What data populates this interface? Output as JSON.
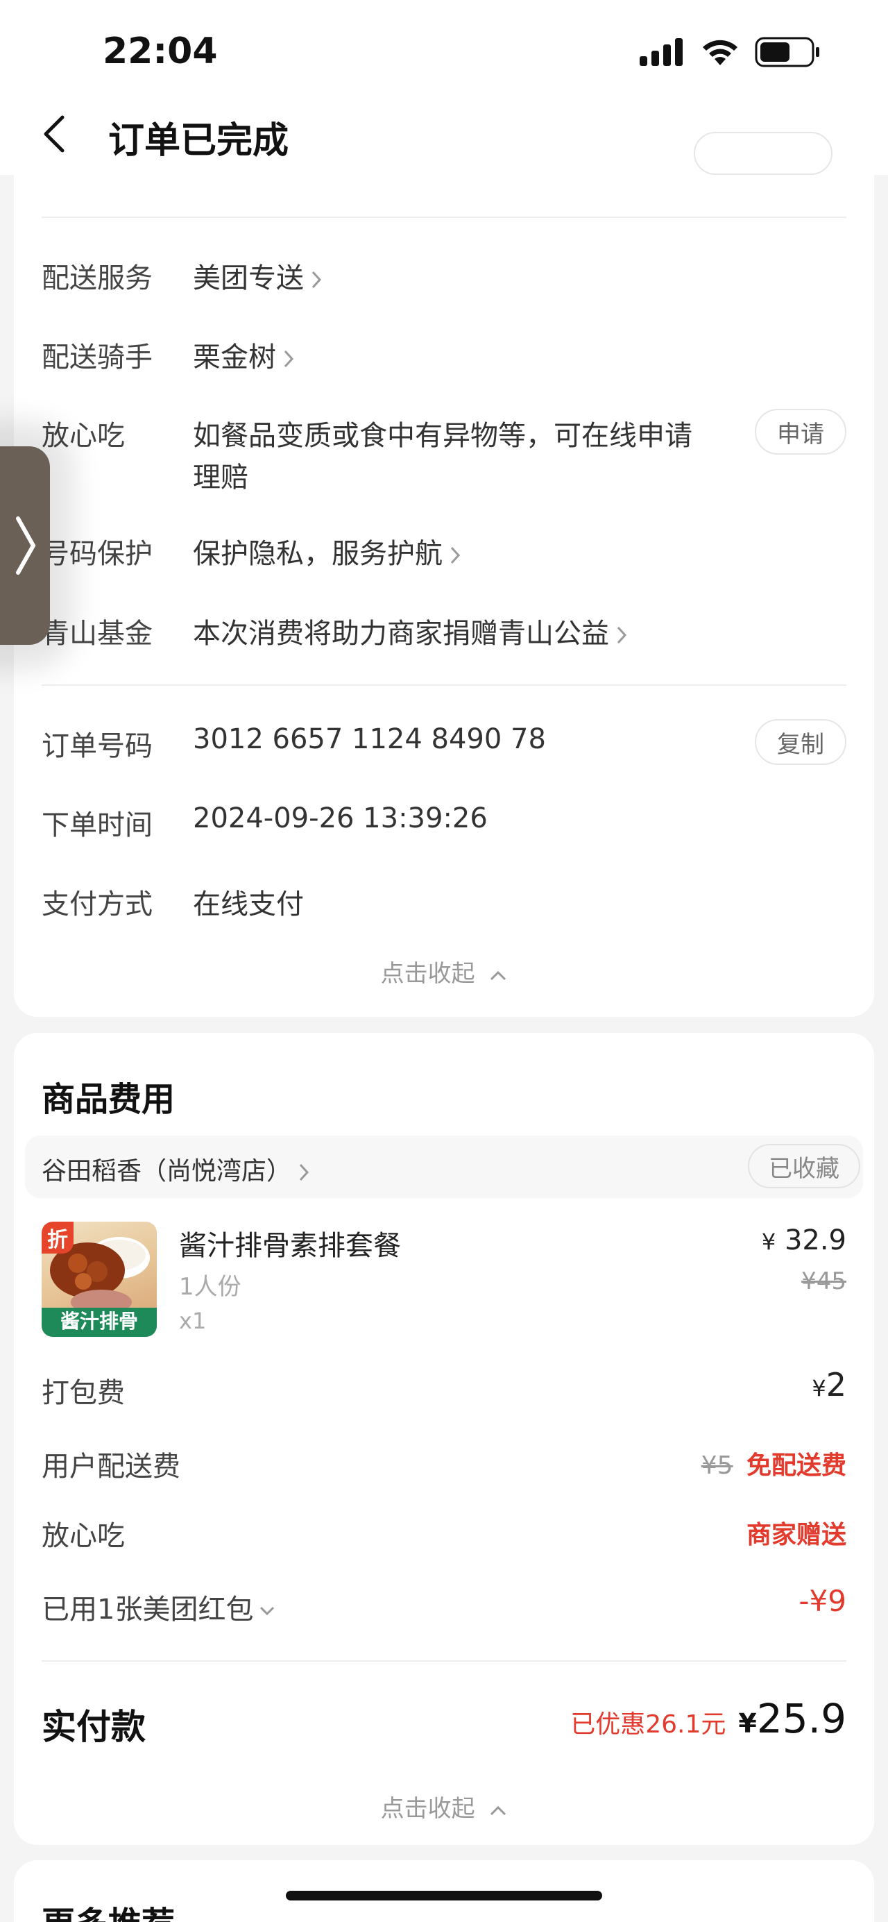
{
  "status_bar": {
    "time": "22:04"
  },
  "nav": {
    "title": "订单已完成"
  },
  "delivery": {
    "service_label": "配送服务",
    "service_value": "美团专送",
    "rider_label": "配送骑手",
    "rider_value": "栗金树",
    "safe_label": "放心吃",
    "safe_value_line1": "如餐品变质或食中有异物等，可在线申请",
    "safe_value_line2": "理赔",
    "safe_button": "申请",
    "privacy_label": "号码保护",
    "privacy_value": "保护隐私，服务护航",
    "fund_label": "青山基金",
    "fund_value": "本次消费将助力商家捐赠青山公益"
  },
  "order": {
    "number_label": "订单号码",
    "number_value": "3012 6657 1124 8490 78",
    "copy_button": "复制",
    "time_label": "下单时间",
    "time_value": "2024-09-26 13:39:26",
    "pay_label": "支付方式",
    "pay_value": "在线支付"
  },
  "collapse_label": "点击收起",
  "fees": {
    "title": "商品费用",
    "shop_name": "谷田稻香（尚悦湾店）",
    "shop_fav": "已收藏",
    "item": {
      "name": "酱汁排骨素排套餐",
      "spec": "1人份",
      "qty": "x1",
      "price": "32.9",
      "orig_price": "¥45",
      "badge": "折",
      "image_label": "酱汁排骨"
    },
    "currency": "¥",
    "pack_label": "打包费",
    "pack_value": "2",
    "delivery_label": "用户配送费",
    "delivery_orig": "¥5",
    "delivery_value": "免配送费",
    "safe_label": "放心吃",
    "safe_value": "商家赠送",
    "redpack_label": "已用1张美团红包",
    "redpack_value": "-¥9",
    "total_label": "实付款",
    "discount_text": "已优惠26.1元",
    "total_value": "25.9"
  },
  "more": {
    "title": "更多推荐"
  },
  "colors": {
    "accent_red": "#e23a2c",
    "card_bg": "#ffffff",
    "page_bg": "#f4f4f4"
  }
}
